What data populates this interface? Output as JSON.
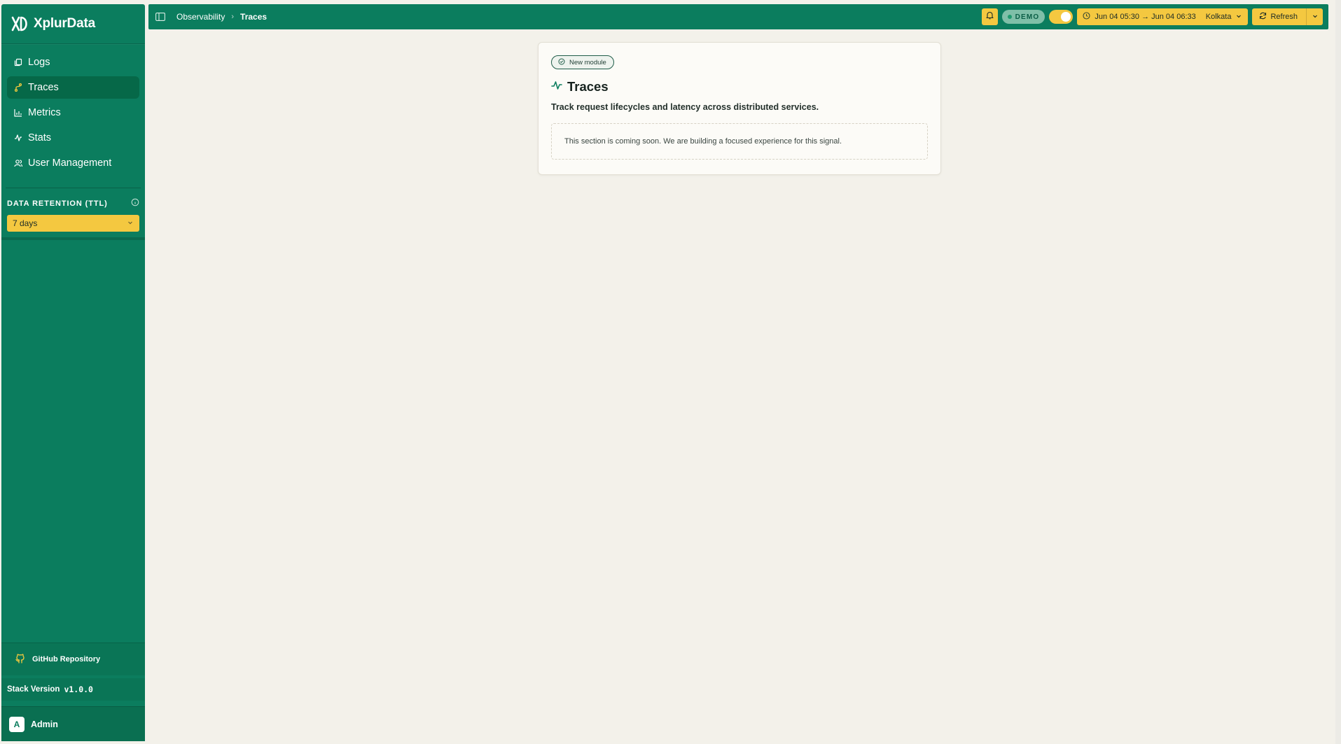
{
  "brand": {
    "name": "XplurData"
  },
  "sidebar": {
    "items": [
      {
        "label": "Logs",
        "icon": "logs-icon"
      },
      {
        "label": "Traces",
        "icon": "traces-icon"
      },
      {
        "label": "Metrics",
        "icon": "metrics-icon"
      },
      {
        "label": "Stats",
        "icon": "stats-icon"
      },
      {
        "label": "User Management",
        "icon": "users-icon"
      }
    ],
    "active": "Traces",
    "ttl": {
      "label": "DATA RETENTION (TTL)",
      "value": "7 days"
    },
    "github": "GitHub Repository",
    "version_label": "Stack Version",
    "version": "v1.0.0",
    "user": {
      "initial": "A",
      "name": "Admin"
    }
  },
  "header": {
    "breadcrumb": [
      "Observability",
      "Traces"
    ],
    "breadcrumb_sep": "›",
    "demo_label": "DEMO",
    "time_range": "Jun 04 05:30 → Jun 04 06:33",
    "timezone": "Kolkata",
    "refresh_label": "Refresh"
  },
  "card": {
    "badge": "New module",
    "title": "Traces",
    "description": "Track request lifecycles and latency across distributed services.",
    "notice": "This section is coming soon. We are building a focused experience for this signal."
  },
  "colors": {
    "brand_green": "#0b7d5e",
    "accent_yellow": "#f4c840",
    "background": "#f3f1ea"
  }
}
